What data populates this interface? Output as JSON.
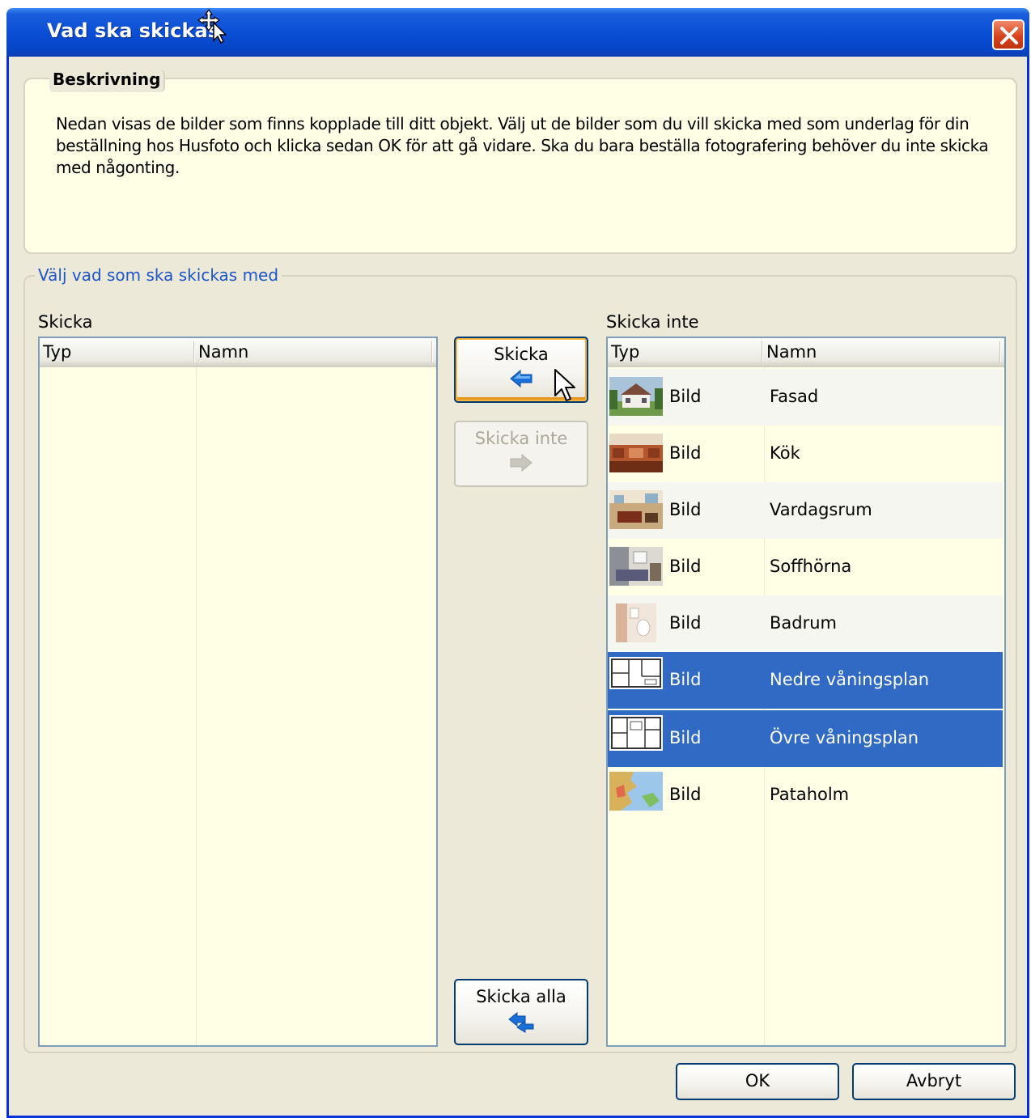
{
  "window": {
    "title": "Vad ska skickas"
  },
  "description": {
    "legend": "Beskrivning",
    "text": "Nedan visas de bilder som finns kopplade till ditt objekt. Välj ut de bilder som du vill skicka med som underlag för din beställning hos Husfoto och klicka sedan OK för att gå vidare. Ska du bara beställa fotografering behöver du inte skicka med någonting."
  },
  "selection": {
    "legend": "Välj vad som ska skickas med",
    "left_list": {
      "label": "Skicka",
      "columns": [
        "Typ",
        "Namn"
      ],
      "rows": []
    },
    "right_list": {
      "label": "Skicka inte",
      "columns": [
        "Typ",
        "Namn"
      ],
      "rows": [
        {
          "type": "Bild",
          "name": "Fasad",
          "thumb": "house-exterior-thumbnail",
          "selected": false
        },
        {
          "type": "Bild",
          "name": "Kök",
          "thumb": "kitchen-thumbnail",
          "selected": false
        },
        {
          "type": "Bild",
          "name": "Vardagsrum",
          "thumb": "living-room-thumbnail",
          "selected": false
        },
        {
          "type": "Bild",
          "name": "Soffhörna",
          "thumb": "sofa-corner-thumbnail",
          "selected": false
        },
        {
          "type": "Bild",
          "name": "Badrum",
          "thumb": "bathroom-thumbnail",
          "selected": false
        },
        {
          "type": "Bild",
          "name": "Nedre våningsplan",
          "thumb": "floorplan-thumbnail",
          "selected": true
        },
        {
          "type": "Bild",
          "name": "Övre våningsplan",
          "thumb": "floorplan-thumbnail",
          "selected": true
        },
        {
          "type": "Bild",
          "name": "Pataholm",
          "thumb": "map-thumbnail",
          "selected": false
        }
      ]
    },
    "buttons": {
      "send": "Skicka",
      "dont_send": "Skicka inte",
      "send_all": "Skicka alla"
    }
  },
  "footer": {
    "ok": "OK",
    "cancel": "Avbryt"
  },
  "colors": {
    "titlebar": "#0a4fd6",
    "selection": "#316ac5",
    "list_bg": "#ffffe6",
    "legend_blue": "#1c56c8",
    "arrow_blue": "#1a6fd8"
  }
}
